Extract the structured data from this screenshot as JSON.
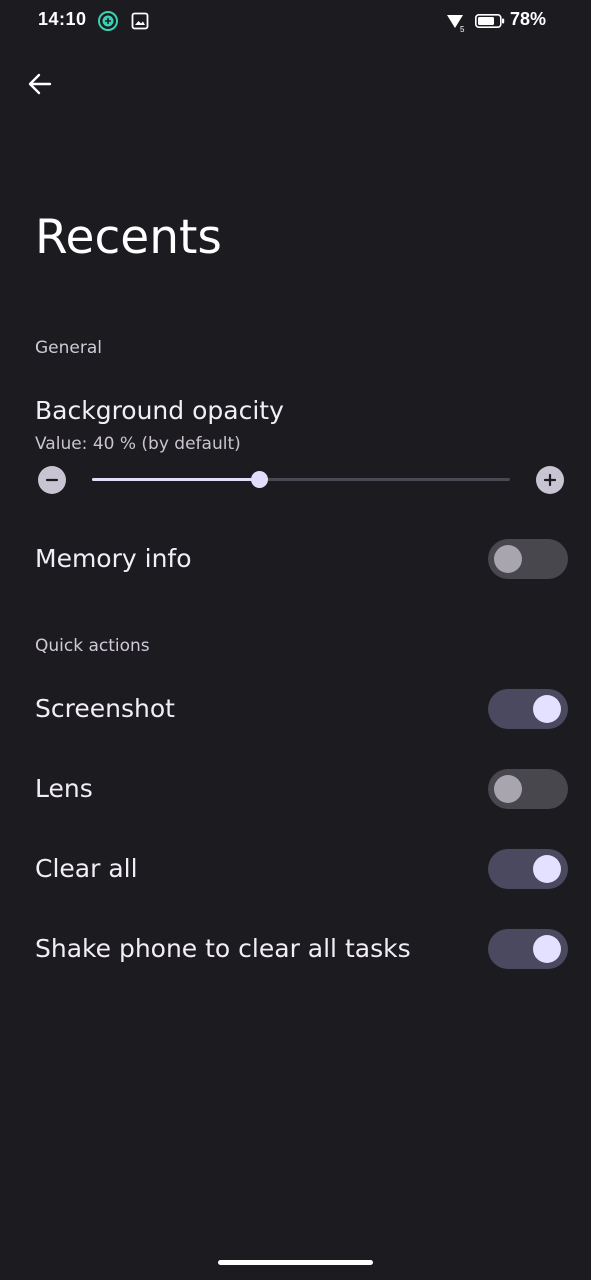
{
  "status_bar": {
    "time": "14:10",
    "battery_percent": "78%",
    "icons": [
      "app-notification-icon",
      "image-notification-icon",
      "signal-icon",
      "battery-icon"
    ]
  },
  "header": {
    "back_icon": "arrow-left-icon",
    "title": "Recents"
  },
  "sections": {
    "general": {
      "label": "General",
      "background_opacity": {
        "title": "Background opacity",
        "value_text": "Value: 40 % (by default)",
        "value": 40,
        "min": 0,
        "max": 100
      },
      "memory_info": {
        "title": "Memory info",
        "enabled": false
      }
    },
    "quick_actions": {
      "label": "Quick actions",
      "items": [
        {
          "title": "Screenshot",
          "enabled": true
        },
        {
          "title": "Lens",
          "enabled": false
        },
        {
          "title": "Clear all",
          "enabled": true
        },
        {
          "title": "Shake phone to clear all tasks",
          "enabled": true
        }
      ]
    }
  },
  "colors": {
    "background": "#1c1b20",
    "accent": "#e0defa",
    "toggle_on_track": "#4a4960",
    "toggle_off_track": "#49474e"
  }
}
